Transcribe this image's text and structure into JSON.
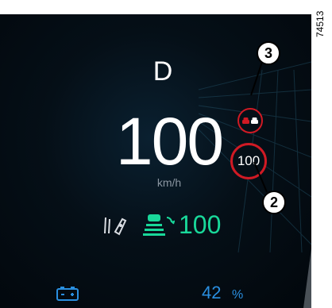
{
  "cluster": {
    "gear": "D",
    "speed": "100",
    "speed_unit": "km/h",
    "speed_limit": "100",
    "cruise_speed": "100",
    "battery_percent": "42",
    "battery_unit": "%",
    "battery_level": 0.42
  },
  "callouts": {
    "front_vehicle_marker": "3",
    "speed_limit_marker": "2"
  },
  "figure": {
    "reference_code": "74513"
  },
  "colors": {
    "accent_green": "#19d89a",
    "battery_blue": "#2a8fe0",
    "warning_red": "#d01a24",
    "background": "#02070c"
  },
  "icons": {
    "driver_alert": "driver-attention-icon",
    "cruise_control": "adaptive-cruise-icon",
    "battery": "battery-icon",
    "front_vehicle": "front-vehicle-warning-icon"
  }
}
